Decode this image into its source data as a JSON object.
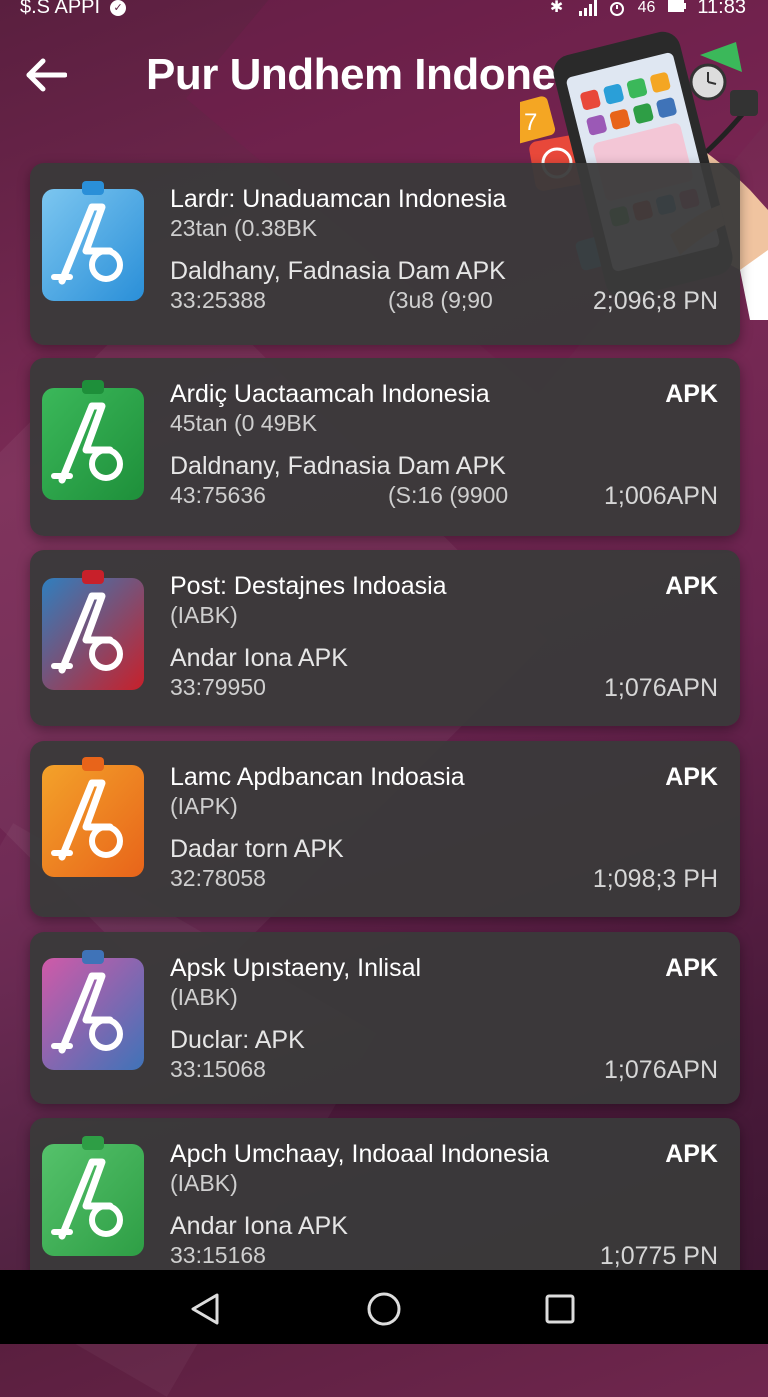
{
  "status_bar": {
    "carrier": "$.S APPI",
    "signal_text": "46",
    "time": "11:83"
  },
  "header": {
    "title": "Pur Undhem Indonesiaa"
  },
  "apps": [
    {
      "title": "Lardr: Unaduamcan Indonesia",
      "subtitle": "23tan (0.38BK",
      "developer": "Daldhany, Fadnasia Dam APK",
      "number": "33:25388",
      "mid_value": "(3u8 (9;90",
      "badge": "",
      "right_value": "2;096;8 PN",
      "colors": [
        "#2a8fd8",
        "#7cc6f0"
      ]
    },
    {
      "title": "Ardiç Uactaamcah Indonesia",
      "subtitle": "45tan (0 49BK",
      "developer": "Daldnany, Fadnasia Dam APK",
      "number": "43:75636",
      "mid_value": "(S:16 (9900",
      "badge": "APK",
      "right_value": "1;006APN",
      "colors": [
        "#1e8f3a",
        "#3bb85a"
      ]
    },
    {
      "title": "Post: Destajnes Indoasia",
      "subtitle": "(IABK)",
      "developer": "Andar Iona APK",
      "number": "33:79950",
      "mid_value": "",
      "badge": "APK",
      "right_value": "1;076APN",
      "colors": [
        "#c8202a",
        "#2f7fbf"
      ]
    },
    {
      "title": "Lamc Apdbancan Indoasia",
      "subtitle": "(IAPK)",
      "developer": "Dadar torn APK",
      "number": "32:78058",
      "mid_value": "",
      "badge": "APK",
      "right_value": "1;098;3 PH",
      "colors": [
        "#e8641a",
        "#f3a22a"
      ]
    },
    {
      "title": "Apsk Upıstaeny, Inlisal",
      "subtitle": "(IABK)",
      "developer": "Duclar: APK",
      "number": "33:15068",
      "mid_value": "",
      "badge": "APK",
      "right_value": "1;076APN",
      "colors": [
        "#3f73b8",
        "#d05aa8"
      ]
    },
    {
      "title": "Apch Umchaay, Indoaal Indonesia",
      "subtitle": "(IABK)",
      "developer": "Andar Iona APK",
      "number": "33:15168",
      "mid_value": "",
      "badge": "APK",
      "right_value": "1;0775 PN",
      "colors": [
        "#2e9e45",
        "#55c26b"
      ]
    }
  ],
  "icons": {
    "back": "arrow-left-icon",
    "bluetooth": "bluetooth-icon",
    "signal": "signal-icon",
    "alarm": "alarm-icon",
    "battery": "battery-icon",
    "nav_back": "triangle-back-icon",
    "nav_home": "circle-home-icon",
    "nav_recents": "square-recents-icon"
  }
}
